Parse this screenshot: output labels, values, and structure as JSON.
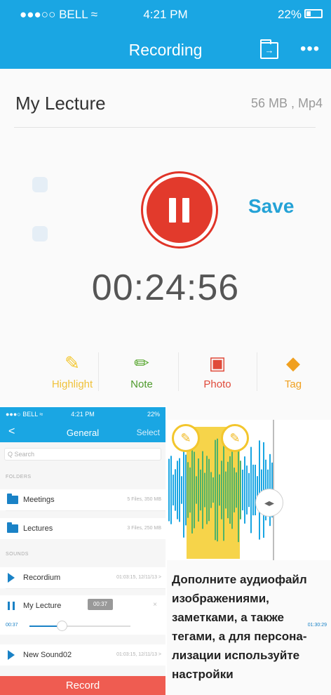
{
  "colors": {
    "accent": "#1aa6e3",
    "record_red": "#e23a2c",
    "save_blue": "#24a2d6",
    "highlight_yellow": "#f3c62d",
    "note_green": "#5aa832",
    "photo_red": "#e04a3a",
    "tag_orange": "#f0a020"
  },
  "status_bar": {
    "carrier": "●●●○○ BELL",
    "wifi": "≈",
    "time": "4:21 PM",
    "battery": "22%"
  },
  "nav": {
    "title": "Recording",
    "folder_icon": "folder-arrow-icon",
    "more": "•••"
  },
  "recording": {
    "name": "My Lecture",
    "meta": "56 MB , Mp4",
    "timer": "00:24:56",
    "save_label": "Save"
  },
  "tools": [
    {
      "label": "Highlight",
      "icon": "✎",
      "icon_name": "highlighter-icon",
      "color": "#f3c62d"
    },
    {
      "label": "Note",
      "icon": "✏",
      "icon_name": "pencil-icon",
      "color": "#5aa832"
    },
    {
      "label": "Photo",
      "icon": "▣",
      "icon_name": "image-icon",
      "color": "#e04a3a"
    },
    {
      "label": "Tag",
      "icon": "◆",
      "icon_name": "tag-icon",
      "color": "#f0a020"
    }
  ],
  "waveform": {
    "marker_icon": "✎",
    "knob_icon": "◂▸"
  },
  "caption": "Дополните аудиофайл изображениями, заметками, а также тегами, а для персона-лизации используйте настройки",
  "inset": {
    "status": {
      "carrier": "●●●○ BELL ≈",
      "time": "4:21 PM",
      "battery": "22%"
    },
    "nav": {
      "back": "<",
      "title": "General",
      "select": "Select"
    },
    "search_placeholder": "Q Search",
    "folders_header": "FOLDERS",
    "folders": [
      {
        "name": "Meetings",
        "info": "5 Files, 350 MB"
      },
      {
        "name": "Lectures",
        "info": "3 Files, 250 MB"
      }
    ],
    "sounds_header": "SOUNDS",
    "sounds": [
      {
        "name": "Recordium",
        "info": "01:03:15, 12/11/13 >"
      },
      {
        "name": "My Lecture",
        "info": "×"
      },
      {
        "name": "New Sound02",
        "info": "01:03:15, 12/11/13 >"
      }
    ],
    "player": {
      "tooltip": "00:37",
      "start": "00:37",
      "end": "01:30:29",
      "progress": 0.32
    },
    "record_label": "Record"
  }
}
